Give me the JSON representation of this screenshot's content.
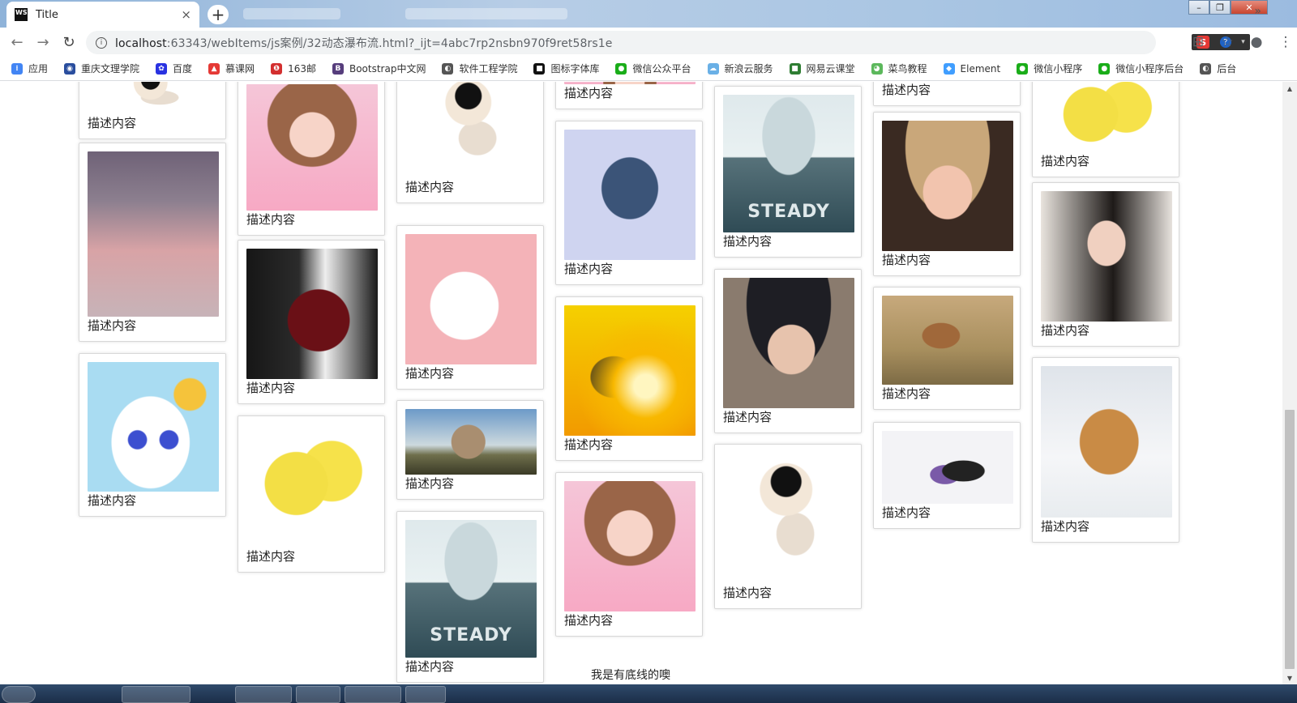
{
  "window": {
    "tab_title": "Title",
    "tab_close": "×",
    "new_tab": "+",
    "minimize": "–",
    "restore": "❐",
    "close": "✕",
    "logo_text": "WS"
  },
  "nav": {
    "back": "←",
    "forward": "→",
    "reload": "↻",
    "url_host": "localhost",
    "url_rest": ":63343/webItems/js案例/32动态瀑布流.html?_ijt=4abc7rp2nsbn970f9ret58rs1e"
  },
  "toolbar_icons": {
    "translate": "⊞",
    "star": "☆",
    "account": "●",
    "menu": "⋮"
  },
  "extensions": {
    "s": "S",
    "q": "?"
  },
  "bookmarks": [
    {
      "label": "应用",
      "color": "#4285f4",
      "icon": "⁝"
    },
    {
      "label": "重庆文理学院",
      "color": "#2a4e9e",
      "icon": "◉"
    },
    {
      "label": "百度",
      "color": "#2932e1",
      "icon": "✿"
    },
    {
      "label": "慕课网",
      "color": "#e53935",
      "icon": "▲"
    },
    {
      "label": "163邮",
      "color": "#d32f2f",
      "icon": "❶"
    },
    {
      "label": "Bootstrap中文网",
      "color": "#563d7c",
      "icon": "B"
    },
    {
      "label": "软件工程学院",
      "color": "#555555",
      "icon": "◐"
    },
    {
      "label": "图标字体库",
      "color": "#111111",
      "icon": "■"
    },
    {
      "label": "微信公众平台",
      "color": "#1aad19",
      "icon": "●"
    },
    {
      "label": "新浪云服务",
      "color": "#6ab0e6",
      "icon": "☁"
    },
    {
      "label": "网易云课堂",
      "color": "#2e7d32",
      "icon": "■"
    },
    {
      "label": "菜鸟教程",
      "color": "#5cb85c",
      "icon": "◕"
    },
    {
      "label": "Element",
      "color": "#409eff",
      "icon": "◆"
    },
    {
      "label": "微信小程序",
      "color": "#1aad19",
      "icon": "●"
    },
    {
      "label": "微信小程序后台",
      "color": "#1aad19",
      "icon": "●"
    },
    {
      "label": "后台",
      "color": "#555555",
      "icon": "◐"
    }
  ],
  "bookmarks_more": "»",
  "caption": "描述内容",
  "footer": "我是有底线的噢",
  "scroll": {
    "up": "▲",
    "down": "▼"
  }
}
